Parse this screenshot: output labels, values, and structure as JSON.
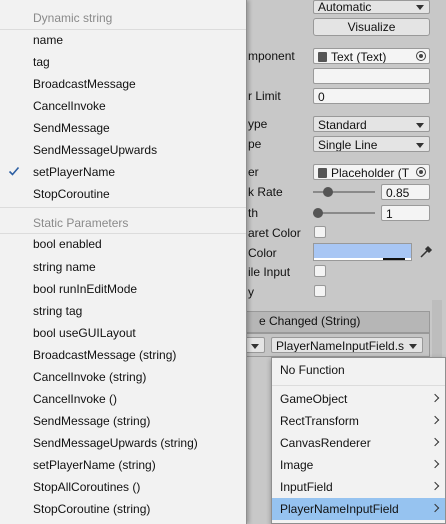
{
  "inspector": {
    "navigation_value": "Automatic",
    "visualize_label": "Visualize",
    "text_component_label": "mponent",
    "text_component_value": "Text (Text)",
    "char_limit_label": "r Limit",
    "char_limit_value": "0",
    "content_type_label": "ype",
    "content_type_value": "Standard",
    "line_type_label": "pe",
    "line_type_value": "Single Line",
    "placeholder_label": "er",
    "placeholder_value": "Placeholder (T",
    "blink_rate_label": "k Rate",
    "blink_rate_value": "0.85",
    "width_label": "th",
    "width_value": "1",
    "caret_color_label": "aret Color",
    "sel_color_label": "Color",
    "mobile_input_label": "ile Input",
    "readonly_label": "y",
    "event_header": "e Changed (String)",
    "event_target_value": "PlayerNameInputField.s"
  },
  "left_menu": {
    "dynamic_header": "Dynamic string",
    "dynamic_items": [
      "name",
      "tag",
      "BroadcastMessage",
      "CancelInvoke",
      "SendMessage",
      "SendMessageUpwards",
      "setPlayerName",
      "StopCoroutine"
    ],
    "checked_item": "setPlayerName",
    "static_header": "Static Parameters",
    "static_items": [
      "bool enabled",
      "string name",
      "bool runInEditMode",
      "string tag",
      "bool useGUILayout",
      "BroadcastMessage (string)",
      "CancelInvoke (string)",
      "CancelInvoke ()",
      "SendMessage (string)",
      "SendMessageUpwards (string)",
      "setPlayerName (string)",
      "StopAllCoroutines ()",
      "StopCoroutine (string)"
    ]
  },
  "right_menu": {
    "no_function": "No Function",
    "items": [
      "GameObject",
      "RectTransform",
      "CanvasRenderer",
      "Image",
      "InputField",
      "PlayerNameInputField"
    ],
    "selected_item": "PlayerNameInputField"
  },
  "colors": {
    "selection_blue": "#96c3f0",
    "color_field": "#a8c6f4"
  }
}
